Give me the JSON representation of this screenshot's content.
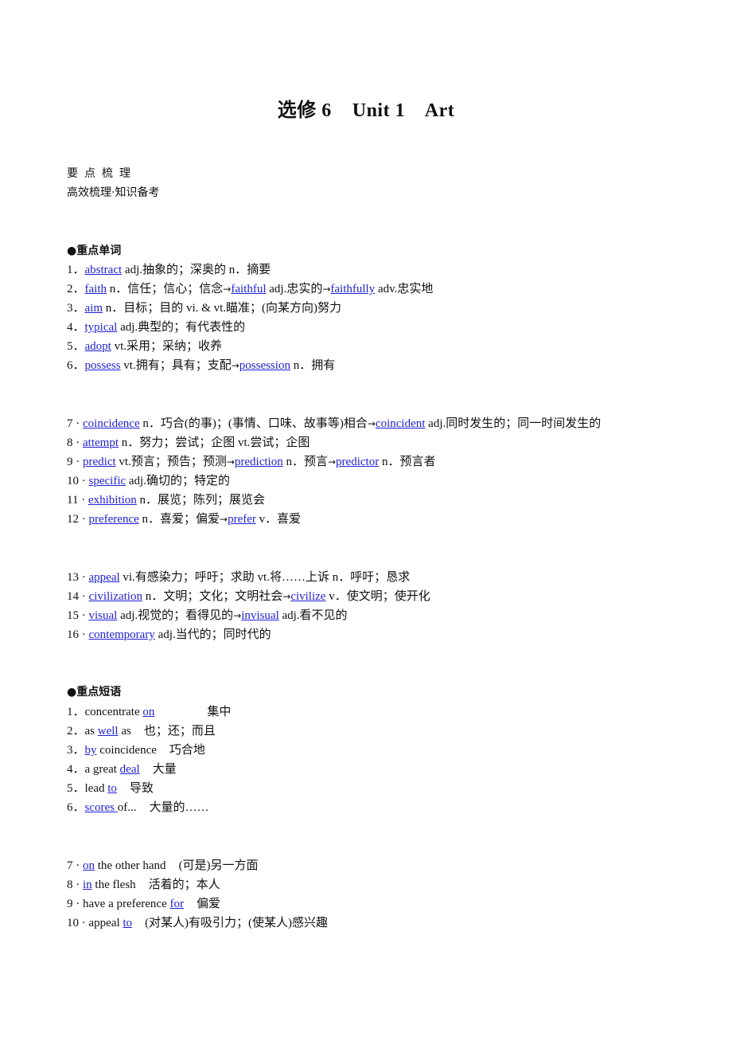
{
  "title": "选修 6    Unit 1    Art",
  "section": {
    "heading": "要点梳理",
    "subheading_left": "高效梳理",
    "subheading_sep": "·",
    "subheading_right": "知识备考"
  },
  "words": {
    "heading": "●重点单词",
    "items": [
      {
        "num": "1．",
        "word": "abstract",
        "rest": " adj.抽象的；深奥的  n．摘要"
      },
      {
        "num": "2．",
        "word": "faith",
        "rest": " n．信任；信心；信念",
        "arrow1": "→",
        "word2": "faithful",
        "rest2": " adj.忠实的",
        "arrow2": "→",
        "word3": "faithfully",
        "rest3": " adv.忠实地"
      },
      {
        "num": "3．",
        "word": "aim",
        "rest": " n．目标；目的  vi. & vt.瞄准；(向某方向)努力"
      },
      {
        "num": "4．",
        "word": "typical",
        "rest": " adj.典型的；有代表性的"
      },
      {
        "num": "5．",
        "word": "adopt",
        "rest": " vt.采用；采纳；收养"
      },
      {
        "num": "6．",
        "word": "possess",
        "rest": " vt.拥有；具有；支配",
        "arrow1": "→",
        "word2": "possession",
        "rest2": " n．拥有"
      },
      {
        "num": "7 · ",
        "word": "coincidence",
        "rest": " n．巧合(的事)；(事情、口味、故事等)相合",
        "arrow1": "→",
        "word2": "coincident",
        "rest2": " adj.同时发生的；同一时间发生的"
      },
      {
        "num": "8 · ",
        "word": "attempt",
        "rest": " n．努力；尝试；企图  vt.尝试；企图"
      },
      {
        "num": "9 · ",
        "word": "predict",
        "rest": " vt.预言；预告；预测",
        "arrow1": "→",
        "word2": "prediction",
        "rest2": " n．预言",
        "arrow2": "→",
        "word3": "predictor",
        "rest3": " n．预言者"
      },
      {
        "num": "10 · ",
        "word": "specific",
        "rest": " adj.确切的；特定的"
      },
      {
        "num": "11 · ",
        "word": "exhibition",
        "rest": " n．展览；陈列；展览会"
      },
      {
        "num": "12 · ",
        "word": "preference",
        "rest": " n．喜爱；偏爱",
        "arrow1": "→",
        "word2": "prefer",
        "rest2": " v．喜爱"
      },
      {
        "num": "13 · ",
        "word": "appeal",
        "rest": " vi.有感染力；呼吁；求助  vt.将……上诉  n．呼吁；恳求"
      },
      {
        "num": "14 · ",
        "word": "civilization",
        "rest": " n．文明；文化；文明社会",
        "arrow1": "→",
        "word2": "civilize",
        "rest2": " v．使文明；使开化"
      },
      {
        "num": "15 · ",
        "word": "visual",
        "rest": " adj.视觉的；看得见的",
        "arrow1": "→",
        "word2": "invisual",
        "rest2": " adj.看不见的"
      },
      {
        "num": "16 · ",
        "word": "contemporary",
        "rest": " adj.当代的；同时代的"
      }
    ]
  },
  "phrases": {
    "heading": "●重点短语",
    "items": [
      {
        "num": "1．",
        "pre": "concentrate ",
        "link": "on",
        "post": "",
        "meaning": "集中"
      },
      {
        "num": "2．",
        "pre": "as ",
        "link": "well",
        "post": " as",
        "meaning": "也；还；而且"
      },
      {
        "num": "3．",
        "pre": "",
        "link": "by",
        "post": " coincidence",
        "meaning": "巧合地"
      },
      {
        "num": "4．",
        "pre": "a great ",
        "link": "deal",
        "post": "",
        "meaning": "大量"
      },
      {
        "num": "5．",
        "pre": "lead ",
        "link": "to",
        "post": "",
        "meaning": "导致"
      },
      {
        "num": "6．",
        "pre": "",
        "link": "scores ",
        "post": "of...",
        "meaning": "大量的……"
      },
      {
        "num": "7 · ",
        "pre": "",
        "link": "on",
        "post": " the other hand",
        "meaning": "(可是)另一方面"
      },
      {
        "num": "8 · ",
        "pre": "",
        "link": "in",
        "post": " the flesh",
        "meaning": "活着的；本人"
      },
      {
        "num": "9 · ",
        "pre": "have a preference ",
        "link": "for",
        "post": "",
        "meaning": "偏爱"
      },
      {
        "num": "10 · ",
        "pre": "appeal ",
        "link": "to",
        "post": "",
        "meaning": "(对某人)有吸引力；(使某人)感兴趣"
      }
    ]
  }
}
